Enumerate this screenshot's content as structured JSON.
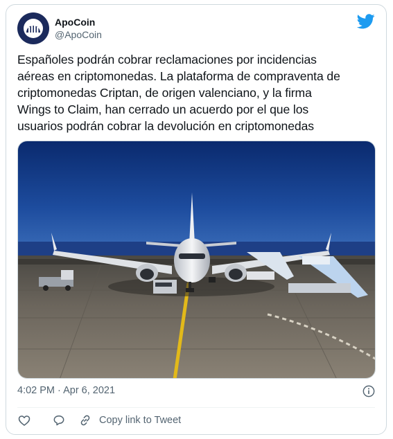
{
  "author": {
    "name": "ApoCoin",
    "handle": "@ApoCoin",
    "avatar_color": "#1b2a5c"
  },
  "brand": {
    "twitter_color": "#1d9bf0",
    "icon": "twitter-bird-icon"
  },
  "tweet": {
    "text_lines": [
      "Españoles podrán cobrar reclamaciones por incidencias",
      "aéreas en criptomonedas. La plataforma de compraventa de",
      "criptomonedas Criptan, de origen valenciano, y la firma",
      "Wings to Claim, han cerrado un acuerdo por el que los",
      "usuarios podrán cobrar la devolución en criptomonedas"
    ],
    "timestamp": "4:02 PM · Apr 6, 2021"
  },
  "actions": {
    "like_icon": "heart-icon",
    "reply_icon": "reply-icon",
    "copy_icon": "link-icon",
    "copy_label": "Copy link to Tweet"
  }
}
